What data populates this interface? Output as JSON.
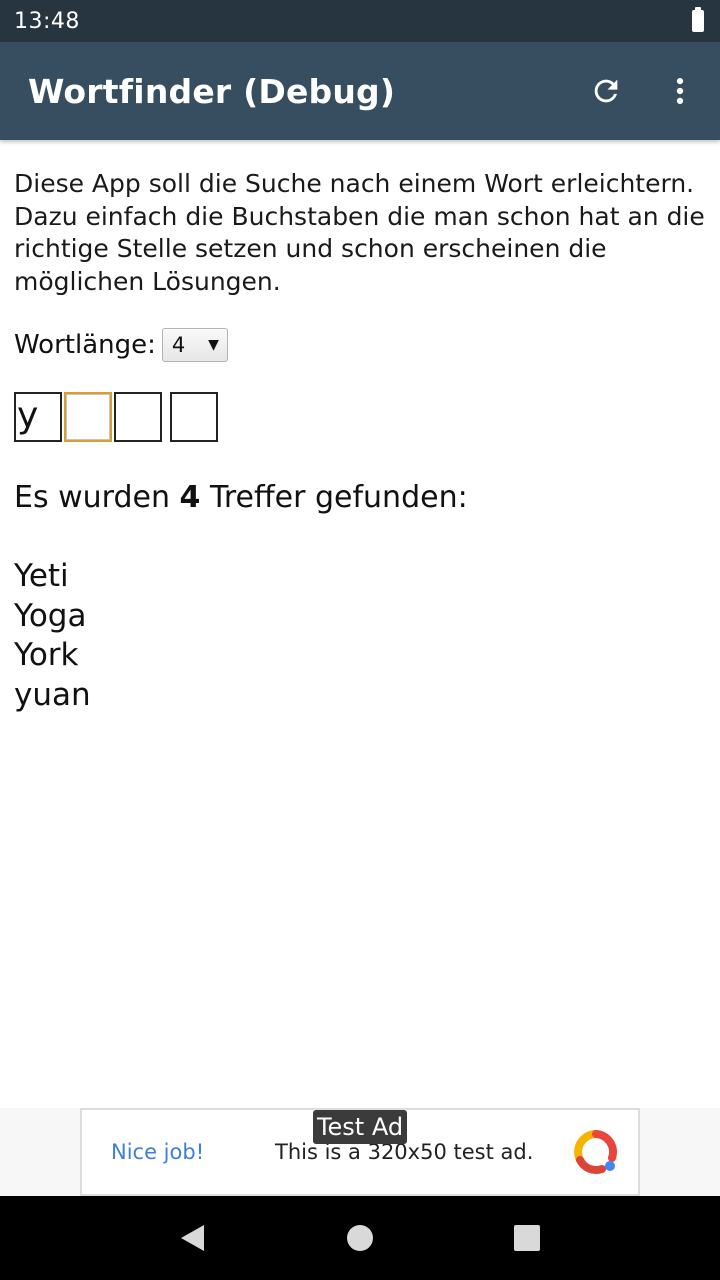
{
  "status_bar": {
    "time": "13:48"
  },
  "app_bar": {
    "title": "Wortfinder (Debug)"
  },
  "intro_text": "Diese App soll die Suche nach einem Wort erleichtern. Dazu einfach die Buchstaben die man schon hat an die richtige Stelle setzen und schon erscheinen die möglichen Lösungen.",
  "word_length": {
    "label": "Wortlänge:",
    "selected": "4"
  },
  "letters": [
    "y",
    "",
    "",
    ""
  ],
  "results": {
    "prefix": "Es wurden ",
    "count": "4",
    "suffix": " Treffer gefunden:",
    "items": [
      "Yeti",
      "Yoga",
      "York",
      "yuan"
    ]
  },
  "ad": {
    "tag": "Test Ad",
    "cta": "Nice job!",
    "text": "This is a 320x50 test ad."
  },
  "colors": {
    "status_bar": "#263540",
    "app_bar": "#364e5f",
    "focus_border": "#d7a02c",
    "ad_cta": "#3f7fd8"
  }
}
